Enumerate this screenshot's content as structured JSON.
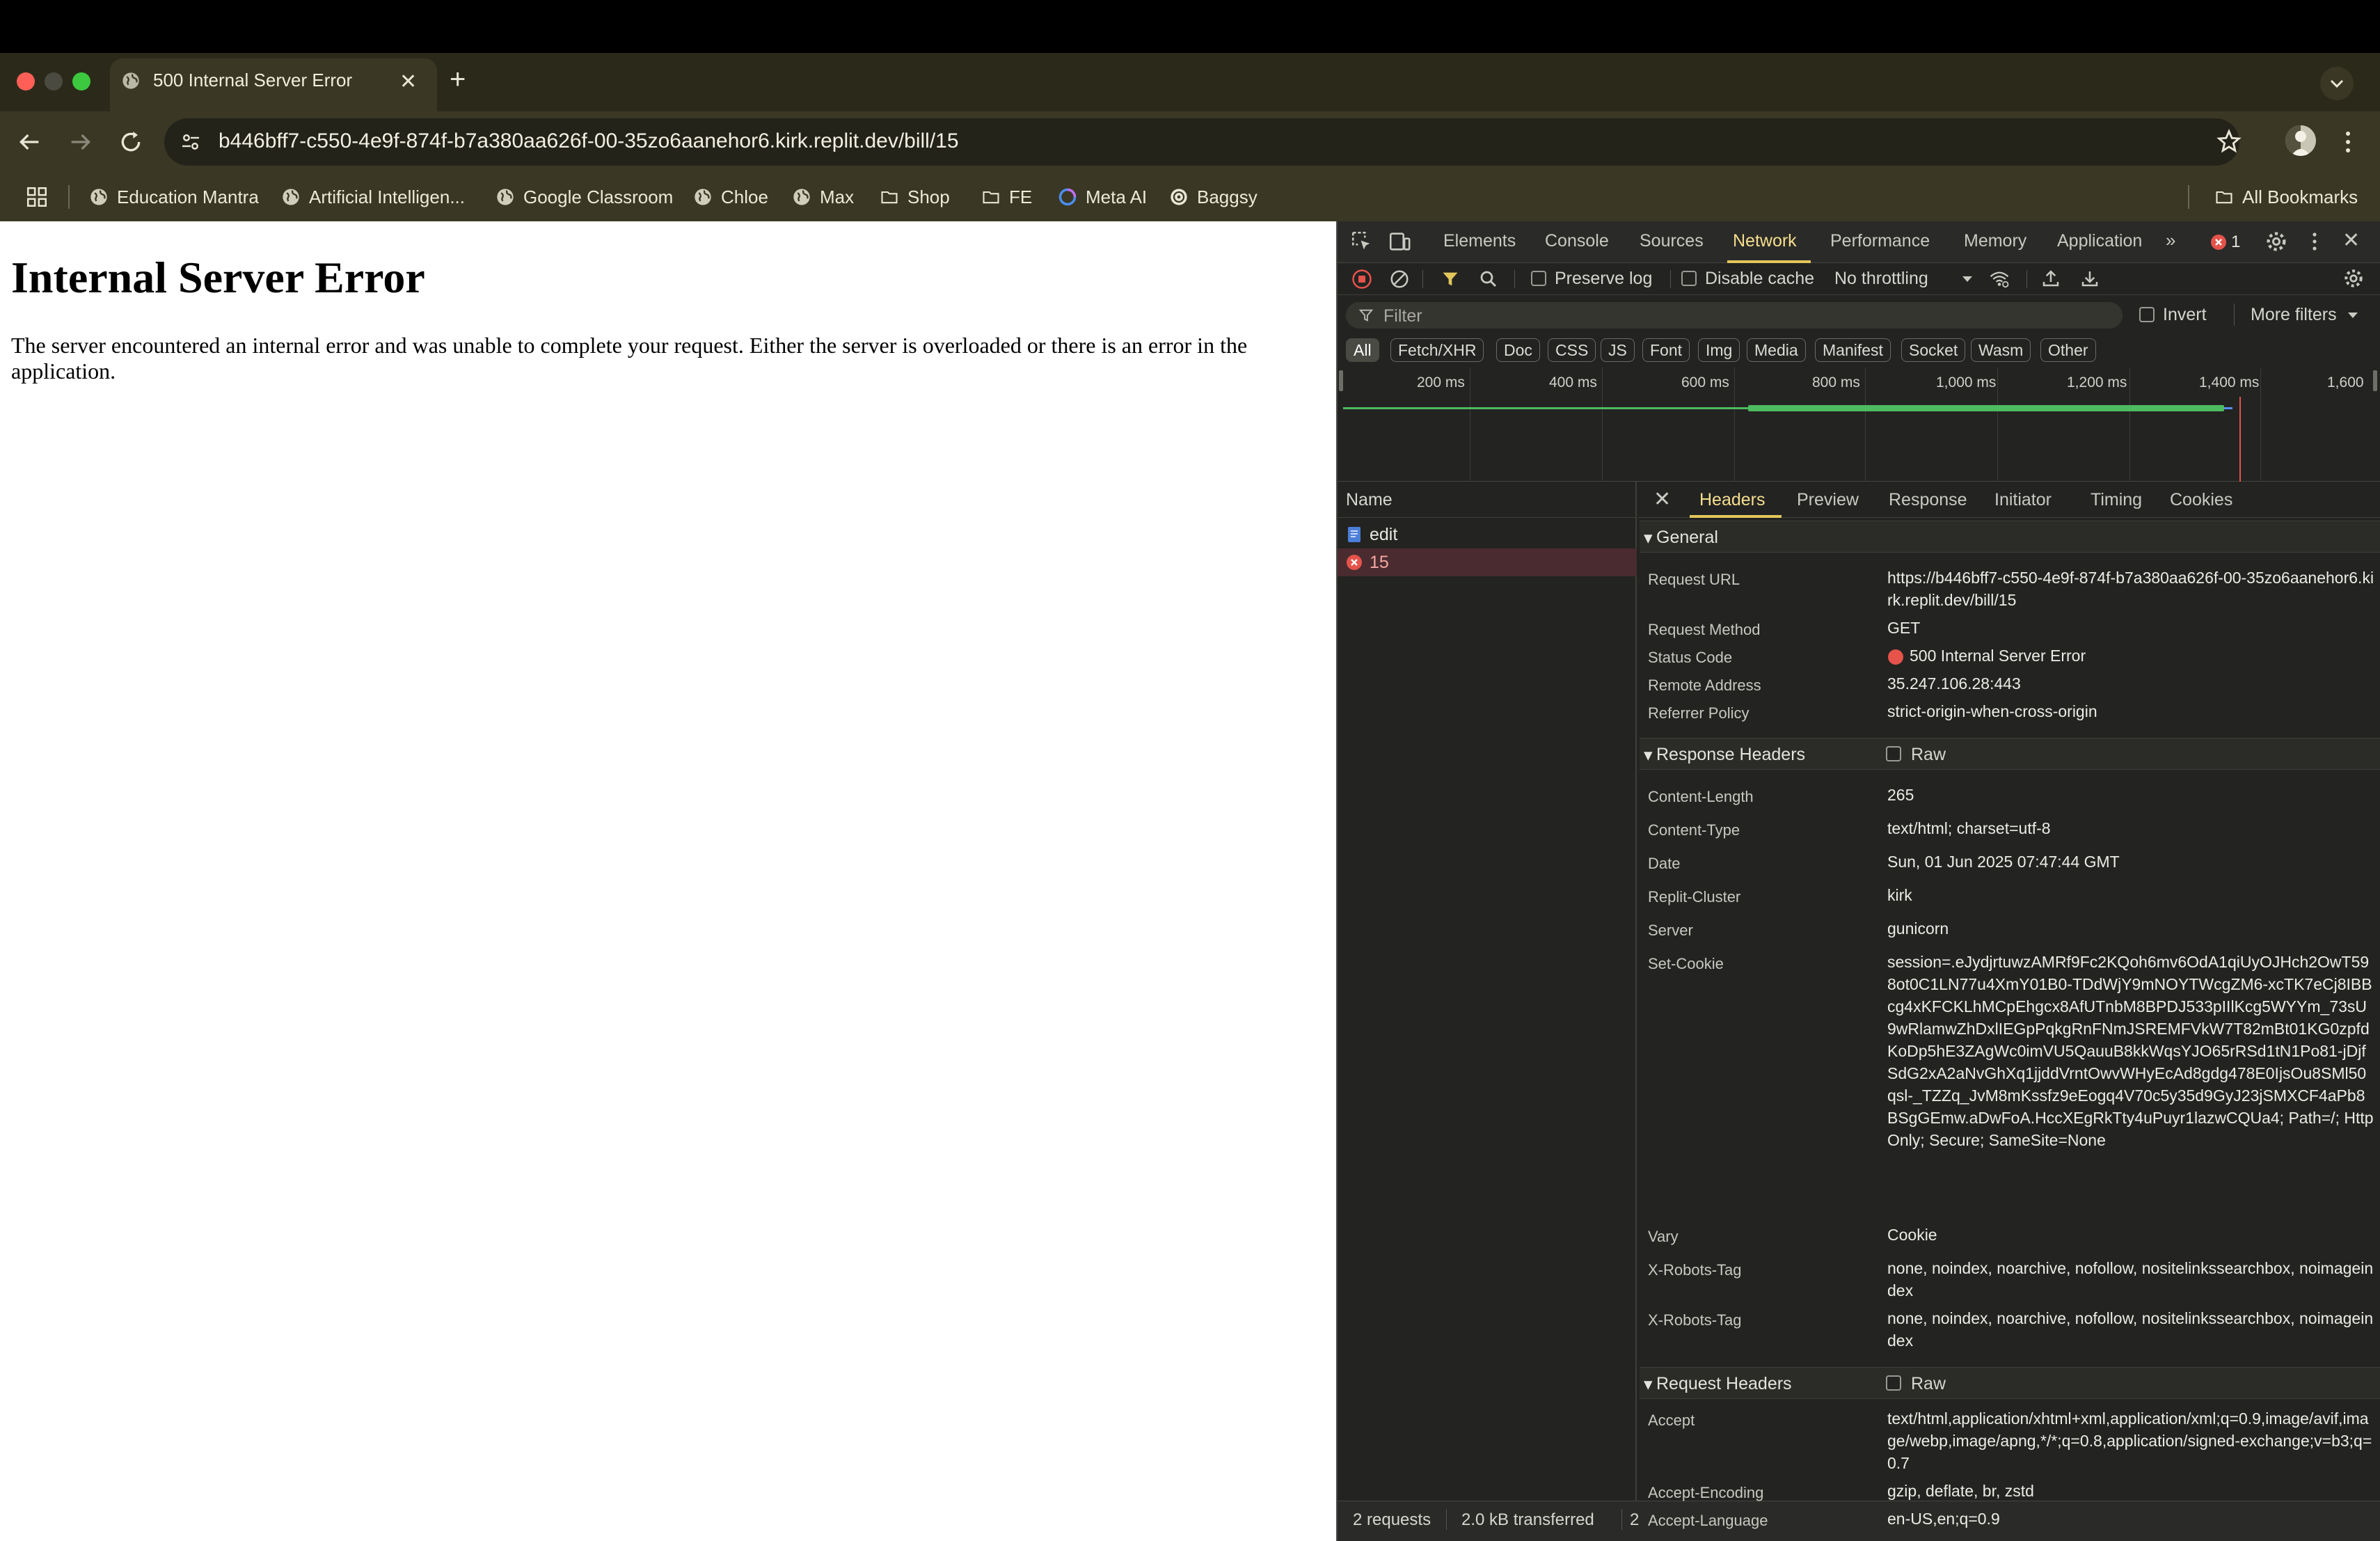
{
  "browser": {
    "tab_title": "500 Internal Server Error",
    "new_tab_symbol": "+",
    "url": "b446bff7-c550-4e9f-874f-b7a380aa626f-00-35zo6aanehor6.kirk.replit.dev/bill/15",
    "bookmarks": [
      {
        "label": "Education Mantra",
        "icon": "globe-icon"
      },
      {
        "label": "Artificial Intelligen...",
        "icon": "globe-icon"
      },
      {
        "label": "Google Classroom",
        "icon": "globe-icon"
      },
      {
        "label": "Chloe",
        "icon": "globe-icon"
      },
      {
        "label": "Max",
        "icon": "globe-icon"
      },
      {
        "label": "Shop",
        "icon": "folder-icon"
      },
      {
        "label": "FE",
        "icon": "folder-icon"
      },
      {
        "label": "Meta AI",
        "icon": "meta-ai-icon"
      },
      {
        "label": "Baggsy",
        "icon": "baggsy-icon"
      }
    ],
    "all_bookmarks": "All Bookmarks"
  },
  "page": {
    "title": "Internal Server Error",
    "body": "The server encountered an internal error and was unable to complete your request. Either the server is overloaded or there is an error in the application."
  },
  "devtools": {
    "tabs": [
      "Elements",
      "Console",
      "Sources",
      "Network",
      "Performance",
      "Memory",
      "Application"
    ],
    "active_tab": "Network",
    "error_count": "1",
    "toolbar": {
      "preserve_log": "Preserve log",
      "disable_cache": "Disable cache",
      "throttling": "No throttling"
    },
    "filter": {
      "placeholder": "Filter",
      "invert": "Invert",
      "more_filters": "More filters"
    },
    "type_filters": [
      "All",
      "Fetch/XHR",
      "Doc",
      "CSS",
      "JS",
      "Font",
      "Img",
      "Media",
      "Manifest",
      "Socket",
      "Wasm",
      "Other"
    ],
    "timeline_ticks": [
      "200 ms",
      "400 ms",
      "600 ms",
      "800 ms",
      "1,000 ms",
      "1,200 ms",
      "1,400 ms",
      "1,600"
    ],
    "request_list": {
      "name_header": "Name",
      "requests": [
        {
          "name": "edit",
          "status": "ok"
        },
        {
          "name": "15",
          "status": "error"
        }
      ]
    },
    "status_bar": {
      "requests": "2 requests",
      "transferred": "2.0 kB transferred",
      "overflow": "2"
    },
    "detail_tabs": [
      "Headers",
      "Preview",
      "Response",
      "Initiator",
      "Timing",
      "Cookies"
    ],
    "active_detail_tab": "Headers",
    "general": {
      "title": "General",
      "rows": [
        {
          "key": "Request URL",
          "value": "https://b446bff7-c550-4e9f-874f-b7a380aa626f-00-35zo6aanehor6.kirk.replit.dev/bill/15"
        },
        {
          "key": "Request Method",
          "value": "GET"
        },
        {
          "key": "Status Code",
          "value": "500 Internal Server Error"
        },
        {
          "key": "Remote Address",
          "value": "35.247.106.28:443"
        },
        {
          "key": "Referrer Policy",
          "value": "strict-origin-when-cross-origin"
        }
      ]
    },
    "response_headers": {
      "title": "Response Headers",
      "raw_label": "Raw",
      "rows": [
        {
          "key": "Content-Length",
          "value": "265"
        },
        {
          "key": "Content-Type",
          "value": "text/html; charset=utf-8"
        },
        {
          "key": "Date",
          "value": "Sun, 01 Jun 2025 07:47:44 GMT"
        },
        {
          "key": "Replit-Cluster",
          "value": "kirk"
        },
        {
          "key": "Server",
          "value": "gunicorn"
        },
        {
          "key": "Set-Cookie",
          "value": "session=.eJydjrtuwzAMRf9Fc2KQoh6mv6OdA1qiUyOJHch2OwT598ot0C1LN77u4XmY01B0-TDdWjY9mNOYTWcgZM6-xcTK7eCj8IBBcg4xKFCKLhMCpEhgcx8AfUTnbM8BPDJ533pIIlKcg5WYYm_73sU9wRlamwZhDxlIEGpPqkgRnFNmJSREMFVkW7T82mBt01KG0zpfdKoDp5hE3ZAgWc0imVU5QauuB8kkWqsYJO65rRSd1tN1Po81-jDjfSdG2xA2aNvGhXq1jjddVrntOwvWHyEcAd8gdg478E0IjsOu8SMl50qsl-_TZZq_JvM8mKssfz9eEogq4V70c5y35d9GyJ23jSMXCF4aPb8BSgGEmw.aDwFoA.HccXEgRkTty4uPuyr1lazwCQUa4; Path=/; HttpOnly; Secure; SameSite=None"
        },
        {
          "key": "Vary",
          "value": "Cookie"
        },
        {
          "key": "X-Robots-Tag",
          "value": "none, noindex, noarchive, nofollow, nositelinkssearchbox, noimageindex"
        },
        {
          "key": "X-Robots-Tag",
          "value": "none, noindex, noarchive, nofollow, nositelinkssearchbox, noimageindex"
        }
      ]
    },
    "request_headers": {
      "title": "Request Headers",
      "raw_label": "Raw",
      "rows": [
        {
          "key": "Accept",
          "value": "text/html,application/xhtml+xml,application/xml;q=0.9,image/avif,image/webp,image/apng,*/*;q=0.8,application/signed-exchange;v=b3;q=0.7"
        },
        {
          "key": "Accept-Encoding",
          "value": "gzip, deflate, br, zstd"
        },
        {
          "key": "Accept-Language",
          "value": "en-US,en;q=0.9"
        }
      ]
    },
    "colors": {
      "accent": "#e3c65b",
      "error": "#e5534b"
    }
  }
}
